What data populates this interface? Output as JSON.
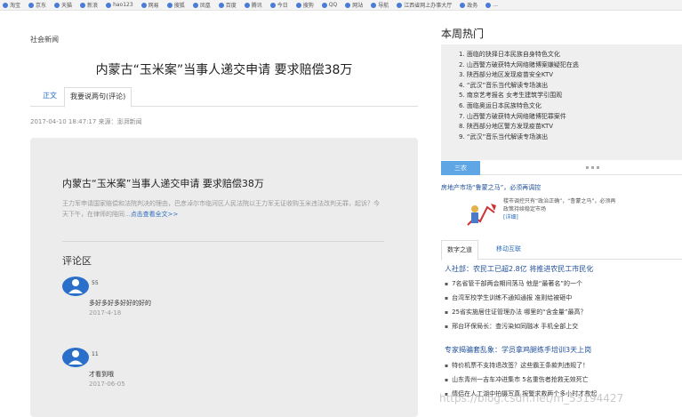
{
  "bookmarks": [
    "淘宝",
    "京东",
    "天猫",
    "新浪",
    "hao123",
    "网易",
    "搜狐",
    "凤凰",
    "百度",
    "腾讯",
    "今日",
    "搜狗",
    "QQ",
    "网站",
    "导航",
    "江西省网上办事大厅",
    "政务",
    "..."
  ],
  "article": {
    "channel": "社会新闻",
    "title": "内蒙古“玉米案”当事人递交申请 要求赔偿38万",
    "tabs": [
      "正文",
      "我要说两句(评论)"
    ],
    "meta": "2017-04-10 18:47:17 来源：澎湃新闻",
    "panel_title": "内蒙古“玉米案”当事人递交申请 要求赔偿38万",
    "summary": "王力军申请国家赔偿和法院判决的理由，巴彦淖尔市临河区人民法院以王力军无证收购玉米违法改判无罪，起诉？今天下午，在律师的陪同...",
    "summary_more": "点击查看全文>>"
  },
  "comments": {
    "heading": "评论区",
    "items": [
      {
        "num": "55",
        "text": "多好多好多好好的好的",
        "date": "2017-4-18"
      },
      {
        "num": "11",
        "text": "才看到哦",
        "date": "2017-06-05"
      }
    ]
  },
  "sidebar": {
    "hot_title": "本周热门",
    "hot_items": [
      "1. 面临的抉择日本民族自身特色文化",
      "2. 山西警方破获特大网络赌博案嫌疑犯在逃",
      "3. 陕西部分地区发现疫苗安全KTV",
      "4. “武汉”音乐当代解读专场演出",
      "5. 南京艺考报名 女考生建筑学引围观",
      "6. 面临奥运日本民族特色文化",
      "7. 山西警方破获特大网络赌博犯罪案件",
      "8. 陕西部分地区警方发现疫苗KTV",
      "9. “武汉”音乐当代解读专场演出"
    ],
    "zone_tab": "三农",
    "feature": {
      "headline": "房地产市场“鲁蒙之马”，必须再调控",
      "desc": "楼市调控只有“政治正确”，“鲁蒙之马”，必须再政策持续稳定市场",
      "more": "[详细]"
    },
    "sub_tabs": [
      "数字之道",
      "移动互联"
    ],
    "news_groups": [
      {
        "head": "人社部：农民工已超2.8亿 将推进农民工市民化",
        "items": [
          "7名省管干部两会期间落马 他是“最著名”的一个",
          "台湾军校学生训练不通知通报 准则给被砸中",
          "25省实施居住证管理办法 哪里的“含金量”最高？",
          "邢台环保局长：查污染如同融冰 手机全部上交"
        ]
      },
      {
        "head": "专家揭骗套乱象：学员拿鸡腿练手培训3天上岗",
        "items": [
          "特价机票不支持退改签？这些霸王条款判违规了！",
          "山东青州一吉车冲进集市 5名重伤者抢救无效死亡",
          "情侣在人工湖中拍摄写真 报警求救两个多小时才救起"
        ]
      }
    ]
  },
  "watermark": "https://blog.csdn.net/m_53194427"
}
